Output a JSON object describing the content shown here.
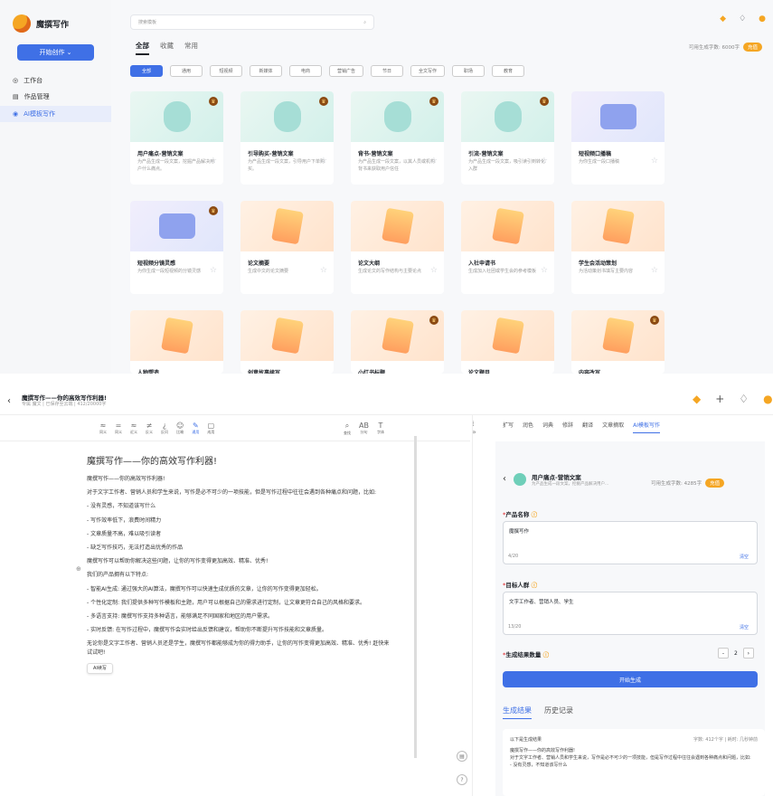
{
  "app": {
    "title": "魔撰写作",
    "create_btn": "开始创作 ⌄"
  },
  "nav": [
    {
      "label": "工作台",
      "icon": "dashboard-icon"
    },
    {
      "label": "作品管理",
      "icon": "folder-icon"
    },
    {
      "label": "AI模板写作",
      "icon": "ai-icon"
    }
  ],
  "search": {
    "placeholder": "搜索模板"
  },
  "tabs": [
    "全部",
    "收藏",
    "常用"
  ],
  "quota": {
    "label": "可用生成字数: 6000字",
    "chip": "充值"
  },
  "categories": [
    "全部",
    "通用",
    "短视频",
    "新媒体",
    "电商",
    "营销广告",
    "节日",
    "全文写作",
    "职场",
    "教育"
  ],
  "cards": [
    {
      "title": "用户痛点-营销文案",
      "desc": "为产品生成一段文案，挖掘产品解决用户什么痛点。",
      "art": "teal",
      "badge": true
    },
    {
      "title": "引导购买-营销文案",
      "desc": "为产品生成一段文案，引导用户下单购买。",
      "art": "teal",
      "badge": true
    },
    {
      "title": "背书-营销文案",
      "desc": "为产品生成一段文案，以其人员或机构背书来获取用户信任",
      "art": "teal",
      "badge": true
    },
    {
      "title": "引流-营销文案",
      "desc": "为产品生成一段文案，吸引读引到转化入群",
      "art": "teal",
      "badge": true
    },
    {
      "title": "短视频口播稿",
      "desc": "为你生成一段口播稿",
      "art": "purple",
      "badge": false
    },
    {
      "title": "短视频分镜灵感",
      "desc": "为你生成一段短视频的分镜灵感",
      "art": "purple",
      "badge": true
    },
    {
      "title": "论文摘要",
      "desc": "生成中文的论文摘要",
      "art": "orange",
      "badge": false
    },
    {
      "title": "论文大纲",
      "desc": "生成论文的写作结构与主要论点",
      "art": "orange",
      "badge": false
    },
    {
      "title": "入社申请书",
      "desc": "生成加入社团或学生会的参考模板",
      "art": "orange",
      "badge": false
    },
    {
      "title": "学生会活动策划",
      "desc": "为活动策划书填写主要内容",
      "art": "orange",
      "badge": false
    },
    {
      "title": "人物塑造",
      "desc": "",
      "art": "orange",
      "badge": false
    },
    {
      "title": "创意故事续写",
      "desc": "",
      "art": "orange",
      "badge": false
    },
    {
      "title": "小红书标题",
      "desc": "",
      "art": "orange",
      "badge": true
    },
    {
      "title": "论文题目",
      "desc": "",
      "art": "orange",
      "badge": false
    },
    {
      "title": "内容改写",
      "desc": "",
      "art": "orange",
      "badge": true
    }
  ],
  "doc": {
    "title": "魔撰写作——你的高效写作利器!",
    "sub": "专属  魔文  |  已保存至云端  |  412/20000字"
  },
  "toolbar": [
    "同义",
    "同义",
    "近义",
    "反义",
    "反问",
    "比喻",
    "通用",
    "成用",
    "查找",
    "分句",
    "字体"
  ],
  "editor": {
    "heading": "魔撰写作——你的高效写作利器!",
    "paras": [
      "魔撰写作——你的高效写作利器!",
      "对于文字工作者、营销人员和学生来说，写作是必不可少的一项技能，但是写作过程中往往会遇到各种痛点和问题，比如:",
      "- 没有灵感，不知道该写什么",
      "- 写作效率低下，浪费时间精力",
      "- 文章质量不高，难以吸引读者",
      "- 缺乏写作技巧，无法打造出优秀的作品",
      "魔撰写作可以帮助你解决这些问题，让你的写作变得更加高效、精准、优秀!",
      "我们的产品拥有以下特点:",
      "- 智能AI生成: 通过强大的AI算法，魔撰写作可以快速生成优质的文章，让你的写作变得更加轻松。",
      "- 个性化定制: 我们提供多种写作模板和主题，用户可以根据自己的需求进行定制，让文章更符合自己的风格和要求。",
      "- 多语言支持: 魔撰写作支持多种语言，能够满足不同国家和地区的用户需求。",
      "- 实时反馈: 在写作过程中，魔撰写作会实时给出反馈和建议，帮助你不断提升写作技能和文章质量。",
      "无论你是文字工作者、营销人员还是学生，魔撰写作都能够成为你的得力助手，让你的写作变得更加高效、精准、优秀! 赶快来试试吧!"
    ],
    "ai_popup": "AI续写"
  },
  "rtabs": [
    "扩写",
    "润色",
    "词典",
    "修辞",
    "翻译",
    "文章摘取",
    "AI模板写作"
  ],
  "tpl": {
    "title": "用户痛点-营销文案",
    "sub": "为产品生成一段文案，挖掘产品解决用户...",
    "quota": "可用生成字数: 4285字",
    "chip": "充值"
  },
  "form": {
    "name_label": "产品名称",
    "name_value": "魔撰写作",
    "name_count": "4/20",
    "clear": "清空",
    "target_label": "目标人群",
    "target_value": "文字工作者、营销人员、学生",
    "target_count": "13/20",
    "qty_label": "生成结果数量",
    "qty": "2",
    "gen_btn": "开始生成"
  },
  "result_tabs": [
    "生成结果",
    "历史记录"
  ],
  "result": {
    "head": "以下是生成结果",
    "meta": "字数: 412个字 | 耗时: 几秒钟前",
    "lines": [
      "魔撰写作——你的高效写作利器!",
      "对于文字工作者、营销人员和学生来说，写作是必不可少的一项技能，但是写作过程中往往会遇到各种痛点和问题，比如:",
      "- 没有灵感，不知道该写什么"
    ]
  }
}
